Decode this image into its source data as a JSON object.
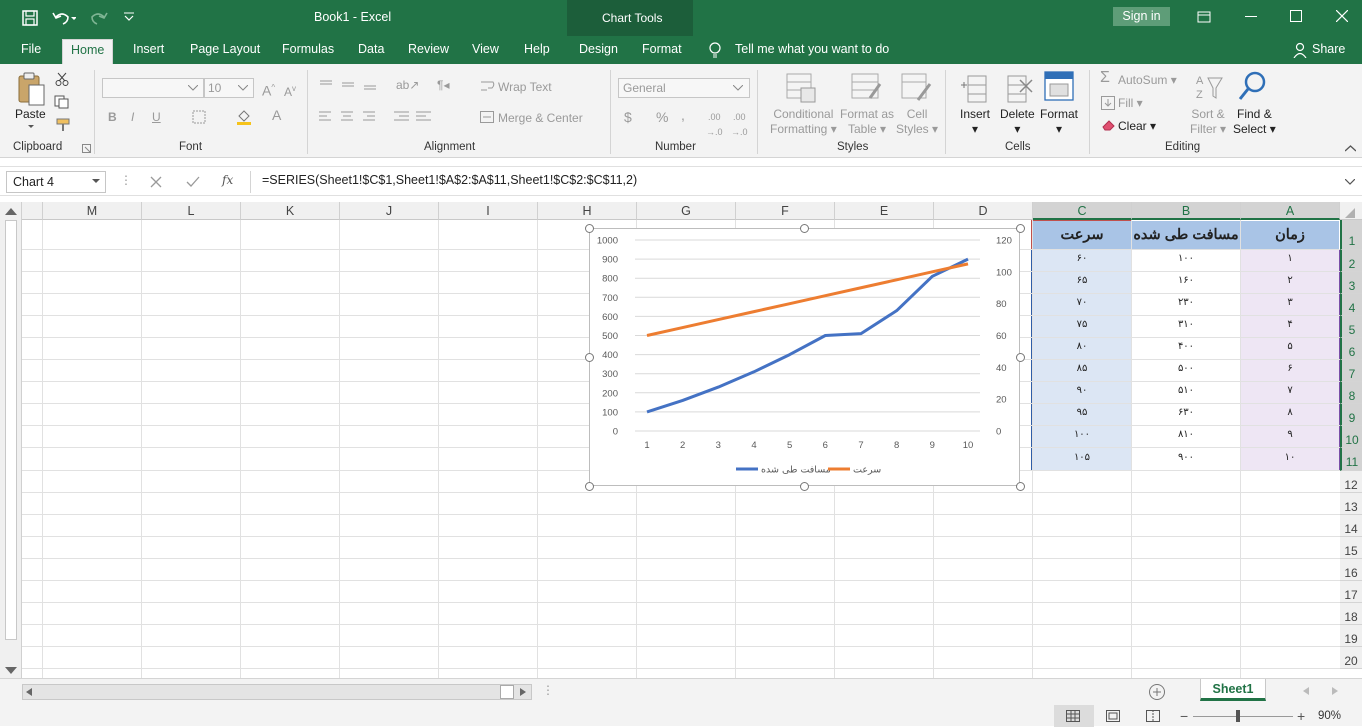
{
  "title_bar": {
    "document_title": "Book1  -  Excel",
    "context_label": "Chart Tools",
    "sign_in": "Sign in"
  },
  "menu": {
    "tabs": [
      "File",
      "Home",
      "Insert",
      "Page Layout",
      "Formulas",
      "Data",
      "Review",
      "View",
      "Help",
      "Design",
      "Format"
    ],
    "tell_me": "Tell me what you want to do",
    "share": "Share"
  },
  "ribbon": {
    "clipboard": {
      "label": "Clipboard",
      "paste": "Paste"
    },
    "font": {
      "label": "Font",
      "font_name": "",
      "font_size": "10",
      "bold": "B",
      "italic": "I",
      "underline": "U"
    },
    "alignment": {
      "label": "Alignment",
      "wrap_text": "Wrap Text",
      "merge_center": "Merge & Center"
    },
    "number": {
      "label": "Number",
      "format": "General"
    },
    "styles": {
      "label": "Styles",
      "conditional": "Conditional",
      "formatting": "Formatting",
      "format_as": "Format as",
      "table": "Table",
      "cell": "Cell",
      "styles_btn": "Styles"
    },
    "cells": {
      "label": "Cells",
      "insert": "Insert",
      "delete": "Delete",
      "format": "Format"
    },
    "editing": {
      "label": "Editing",
      "autosum": "AutoSum",
      "fill": "Fill",
      "clear": "Clear",
      "sort": "Sort &",
      "filter": "Filter",
      "find": "Find &",
      "select": "Select"
    }
  },
  "formula_bar": {
    "name_box": "Chart 4",
    "fx": "fx",
    "formula": "=SERIES(Sheet1!$C$1,Sheet1!$A$2:$A$11,Sheet1!$C$2:$C$11,2)"
  },
  "grid": {
    "columns": [
      "M",
      "L",
      "K",
      "J",
      "I",
      "H",
      "G",
      "F",
      "E",
      "D",
      "C",
      "B",
      "A"
    ],
    "rows": [
      "1",
      "2",
      "3",
      "4",
      "5",
      "6",
      "7",
      "8",
      "9",
      "10",
      "11",
      "12",
      "13",
      "14",
      "15",
      "16",
      "17",
      "18",
      "19",
      "20"
    ],
    "headers": {
      "A": "زمان",
      "B": "مسافت طی شده",
      "C": "سرعت"
    },
    "col_a": [
      "۱",
      "۲",
      "۳",
      "۴",
      "۵",
      "۶",
      "۷",
      "۸",
      "۹",
      "۱۰"
    ],
    "col_b": [
      "۱۰۰",
      "۱۶۰",
      "۲۳۰",
      "۳۱۰",
      "۴۰۰",
      "۵۰۰",
      "۵۱۰",
      "۶۳۰",
      "۸۱۰",
      "۹۰۰"
    ],
    "col_c": [
      "۶۰",
      "۶۵",
      "۷۰",
      "۷۵",
      "۸۰",
      "۸۵",
      "۹۰",
      "۹۵",
      "۱۰۰",
      "۱۰۵"
    ]
  },
  "chart_data": {
    "type": "line",
    "x": [
      1,
      2,
      3,
      4,
      5,
      6,
      7,
      8,
      9,
      10
    ],
    "series": [
      {
        "name": "مسافت طی شده",
        "axis": "left",
        "color": "#4472c4",
        "values": [
          100,
          160,
          230,
          310,
          400,
          500,
          510,
          630,
          810,
          900
        ]
      },
      {
        "name": "سرعت",
        "axis": "right",
        "color": "#ed7d31",
        "values": [
          60,
          65,
          70,
          75,
          80,
          85,
          90,
          95,
          100,
          105
        ]
      }
    ],
    "y_left": {
      "ticks": [
        "0",
        "100",
        "200",
        "300",
        "400",
        "500",
        "600",
        "700",
        "800",
        "900",
        "1000"
      ],
      "ylim": [
        0,
        1000
      ]
    },
    "y_right": {
      "ticks": [
        "0",
        "20",
        "40",
        "60",
        "80",
        "100",
        "120"
      ],
      "ylim": [
        0,
        120
      ]
    },
    "x_ticks": [
      "1",
      "2",
      "3",
      "4",
      "5",
      "6",
      "7",
      "8",
      "9",
      "10"
    ],
    "grid": true,
    "legend": "bottom"
  },
  "status_bar": {
    "sheet_tab": "Sheet1",
    "zoom": "90%"
  }
}
